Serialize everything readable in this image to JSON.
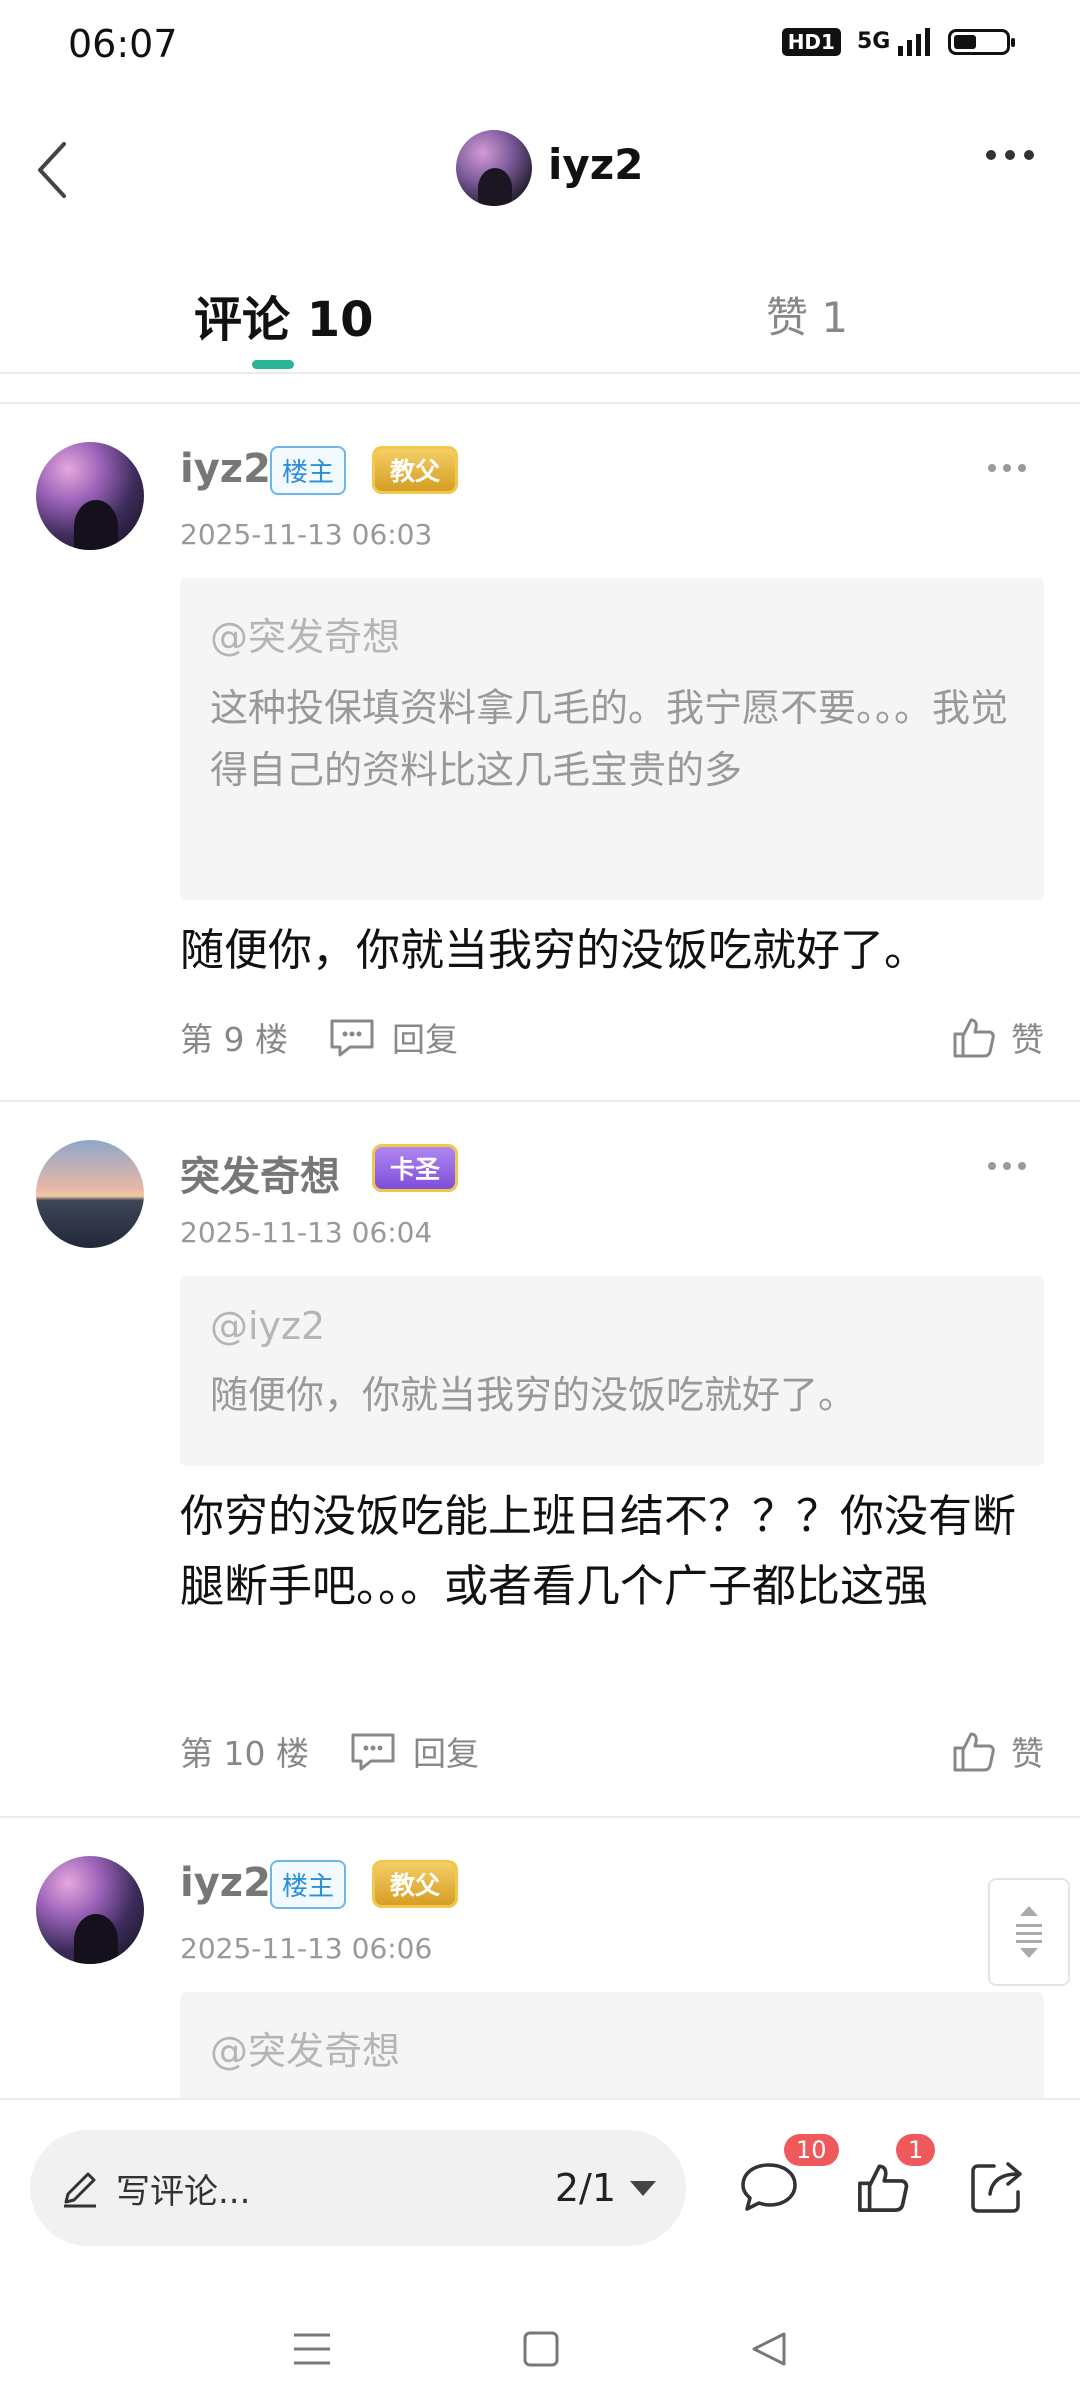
{
  "status_bar": {
    "time": "06:07",
    "hd": "HD1",
    "network": "5G"
  },
  "header": {
    "title": "iyz2"
  },
  "tabs": [
    {
      "label": "评论 10",
      "active": true
    },
    {
      "label": "赞 1",
      "active": false
    }
  ],
  "comments": [
    {
      "author": "iyz2",
      "owner_badge": "楼主",
      "rank_badge": "教父",
      "time": "2025-11-13 06:03",
      "quote_user": "@突发奇想",
      "quote_text": "这种投保填资料拿几毛的。我宁愿不要。。。我觉得自己的资料比这几毛宝贵的多",
      "text": "随便你，你就当我穷的没饭吃就好了。",
      "floor": "第 9 楼",
      "reply_label": "回复",
      "like_label": "赞"
    },
    {
      "author": "突发奇想",
      "rank_badge": "卡圣",
      "time": "2025-11-13 06:04",
      "quote_user": "@iyz2",
      "quote_text": "随便你，你就当我穷的没饭吃就好了。",
      "text": "你穷的没饭吃能上班日结不？？？你没有断腿断手吧。。。或者看几个广子都比这强",
      "floor": "第 10 楼",
      "reply_label": "回复",
      "like_label": "赞"
    },
    {
      "author": "iyz2",
      "owner_badge": "楼主",
      "rank_badge": "教父",
      "time": "2025-11-13 06:06",
      "quote_user": "@突发奇想"
    }
  ],
  "bottom_bar": {
    "write_placeholder": "写评论...",
    "page_indicator": "2/1",
    "comment_count": "10",
    "like_count": "1"
  },
  "colors": {
    "accent": "#2bb596",
    "badge_red": "#f0595b",
    "owner_badge_blue": "#2a8fd6"
  }
}
